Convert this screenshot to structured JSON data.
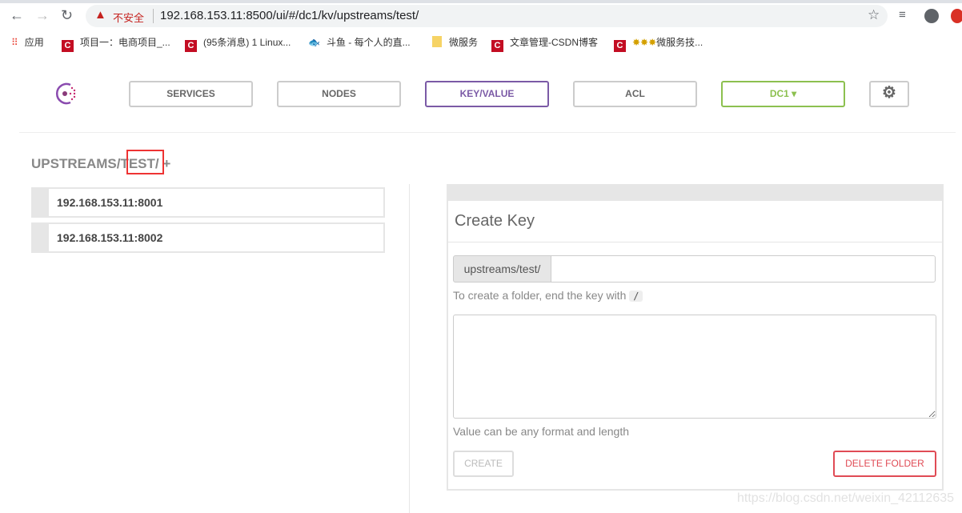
{
  "browser": {
    "back": "←",
    "forward": "→",
    "reload": "↻",
    "security_label": "不安全",
    "url": "192.168.153.11:8500/ui/#/dc1/kv/upstreams/test/",
    "bookmarks": [
      "应用",
      "项目一：电商项目_...",
      "(95条消息) 1 Linux...",
      "斗鱼 - 每个人的直...",
      "微服务",
      "文章管理-CSDN博客",
      "微服务技..."
    ]
  },
  "nav": {
    "services": "SERVICES",
    "nodes": "NODES",
    "kv": "KEY/VALUE",
    "acl": "ACL",
    "dc": "DC1 ▾",
    "accent": "#7b5aa6",
    "dc_color": "#8cc04f"
  },
  "breadcrumb": {
    "path": "UPSTREAMS/TEST/",
    "add": "+"
  },
  "keys": [
    "192.168.153.11:8001",
    "192.168.153.11:8002"
  ],
  "panel": {
    "title": "Create Key",
    "prefix": "upstreams/test/",
    "key_value": "",
    "help_folder": "To create a folder, end the key with",
    "slash": "/",
    "value": "",
    "help_value": "Value can be any format and length",
    "create": "CREATE",
    "delete": "DELETE FOLDER"
  },
  "watermark": "https://blog.csdn.net/weixin_42112635"
}
